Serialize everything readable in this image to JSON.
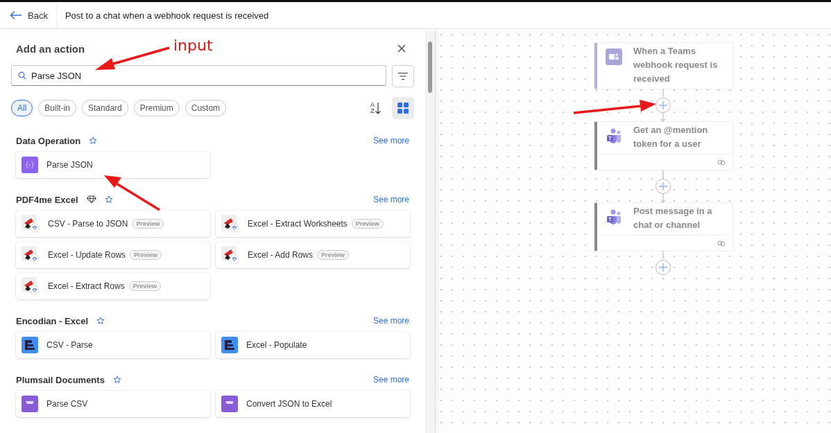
{
  "header": {
    "back_label": "Back",
    "title": "Post to a chat when a webhook request is received"
  },
  "panel": {
    "title": "Add an action",
    "search": {
      "value": "Parse JSON"
    },
    "filters": [
      {
        "label": "All",
        "selected": true
      },
      {
        "label": "Built-in",
        "selected": false
      },
      {
        "label": "Standard",
        "selected": false
      },
      {
        "label": "Premium",
        "selected": false
      },
      {
        "label": "Custom",
        "selected": false
      }
    ],
    "sort_letters": [
      "A",
      "Z"
    ],
    "view_grid_selected": true,
    "sections": [
      {
        "title": "Data Operation",
        "premium": false,
        "see_more": "See more",
        "items": [
          {
            "label": "Parse JSON",
            "kind": "data-operation"
          }
        ]
      },
      {
        "title": "PDF4me Excel",
        "premium": true,
        "see_more": "See more",
        "items": [
          {
            "label": "CSV - Parse to JSON",
            "kind": "pdf4me",
            "badge": "Preview"
          },
          {
            "label": "Excel - Extract Worksheets",
            "kind": "pdf4me",
            "badge": "Preview"
          },
          {
            "label": "Excel - Update Rows",
            "kind": "pdf4me",
            "badge": "Preview"
          },
          {
            "label": "Excel - Add Rows",
            "kind": "pdf4me",
            "badge": "Preview"
          },
          {
            "label": "Excel - Extract Rows",
            "kind": "pdf4me",
            "badge": "Preview"
          }
        ]
      },
      {
        "title": "Encodian - Excel",
        "premium": false,
        "see_more": "See more",
        "items": [
          {
            "label": "CSV - Parse",
            "kind": "encodian"
          },
          {
            "label": "Excel - Populate",
            "kind": "encodian"
          }
        ]
      },
      {
        "title": "Plumsail Documents",
        "premium": false,
        "see_more": "See more",
        "items": [
          {
            "label": "Parse CSV",
            "kind": "plumsail"
          },
          {
            "label": "Convert JSON to Excel",
            "kind": "plumsail"
          }
        ]
      }
    ]
  },
  "flow": {
    "nodes": [
      {
        "title": "When a Teams webhook request is received",
        "kind": "trigger"
      },
      {
        "title": "Get an @mention token for a user",
        "kind": "action"
      },
      {
        "title": "Post message in a chat or channel",
        "kind": "action"
      }
    ]
  },
  "annotations": [
    {
      "kind": "label",
      "text": "input"
    }
  ]
}
